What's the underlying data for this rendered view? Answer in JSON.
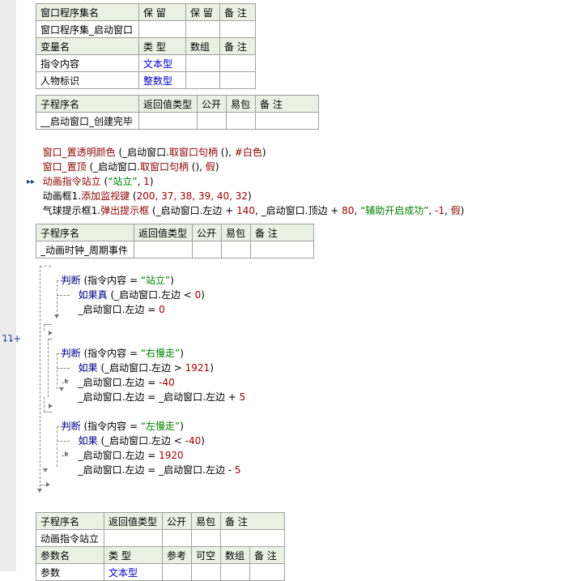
{
  "assembly_table": {
    "header": [
      "窗口程序集名",
      "保 留",
      "保 留",
      "备 注"
    ],
    "row": [
      "窗口程序集_启动窗口",
      "",
      "",
      ""
    ],
    "var_header": [
      "变量名",
      "类 型",
      "数组",
      "备 注"
    ],
    "vars": [
      [
        "指令内容",
        "文本型",
        "",
        ""
      ],
      [
        "人物标识",
        "整数型",
        "",
        ""
      ]
    ]
  },
  "sub1": {
    "header": [
      "子程序名",
      "返回值类型",
      "公开",
      "易包",
      "备 注"
    ],
    "row": [
      "__启动窗口_创建完毕",
      "",
      "",
      "",
      ""
    ],
    "code": {
      "l1a": "窗口_置透明颜色",
      "l1b": " (_启动窗口.",
      "l1c": "取窗口句柄",
      "l1d": " (), ",
      "l1e": "#白色",
      "l1f": ")",
      "l2a": "窗口_置顶",
      "l2b": " (_启动窗口.",
      "l2c": "取窗口句柄",
      "l2d": " (), ",
      "l2e": "假",
      "l2f": ")",
      "l3a": "动画指令站立",
      "l3b": " (",
      "l3c": "“站立”",
      "l3d": ", ",
      "l3e": "1",
      "l3f": ")",
      "l4a": "动画框1.",
      "l4b": "添加监视键",
      "l4c": " (",
      "l4d": "200, 37, 38, 39, 40, 32",
      "l4e": ")",
      "l5a": "气球提示框1.",
      "l5b": "弹出提示框",
      "l5c": " (_启动窗口.左边 + ",
      "l5d": "140",
      "l5e": ", _启动窗口.顶边 + ",
      "l5f": "80",
      "l5g": ", ",
      "l5h": "“辅助开启成功”",
      "l5i": ", ",
      "l5j": "-1",
      "l5k": ", ",
      "l5l": "假",
      "l5m": ")"
    }
  },
  "sub2": {
    "header": [
      "子程序名",
      "返回值类型",
      "公开",
      "易包",
      "备 注"
    ],
    "row": [
      "_动画时钟_周期事件",
      "",
      "",
      "",
      ""
    ],
    "code": {
      "j1a": "判断",
      "j1b": " (指令内容 = ",
      "j1c": "“站立”",
      "j1d": ")",
      "j1e": "如果真",
      "j1f": " (_启动窗口.左边 < ",
      "j1g": "0",
      "j1h": ")",
      "j1i": "_启动窗口.左边 = ",
      "j1j": "0",
      "j2a": "判断",
      "j2b": " (指令内容 = ",
      "j2c": "“右慢走”",
      "j2d": ")",
      "j2e": "如果",
      "j2f": " (_启动窗口.左边 > ",
      "j2g": "1921",
      "j2h": ")",
      "j2i": "_启动窗口.左边 = ",
      "j2j": "-40",
      "j2k": "_启动窗口.左边 = _启动窗口.左边 + ",
      "j2l": "5",
      "j3a": "判断",
      "j3b": " (指令内容 = ",
      "j3c": "“左慢走”",
      "j3d": ")",
      "j3e": "如果",
      "j3f": " (_启动窗口.左边 < ",
      "j3g": "-40",
      "j3h": ")",
      "j3i": "_启动窗口.左边 = ",
      "j3j": "1920",
      "j3k": "_启动窗口.左边 = _启动窗口.左边 - ",
      "j3l": "5"
    }
  },
  "sub3": {
    "header": [
      "子程序名",
      "返回值类型",
      "公开",
      "易包",
      "备 注"
    ],
    "row": [
      "动画指令站立",
      "",
      "",
      "",
      ""
    ],
    "param_header": [
      "参数名",
      "类 型",
      "参考",
      "可空",
      "数组",
      "备 注"
    ],
    "param_row": [
      "参数",
      "文本型",
      "",
      "",
      "",
      ""
    ]
  },
  "gutter_marker": "⮧⮧+",
  "icons": {
    "breakpoint": "double-arrow-icon",
    "fold": "fold-plus-icon"
  },
  "colors": {
    "keyword": "#00008b",
    "function": "#8b0000",
    "string": "#008000",
    "number": "#a00000",
    "header_bg": "#eaf1e2"
  }
}
